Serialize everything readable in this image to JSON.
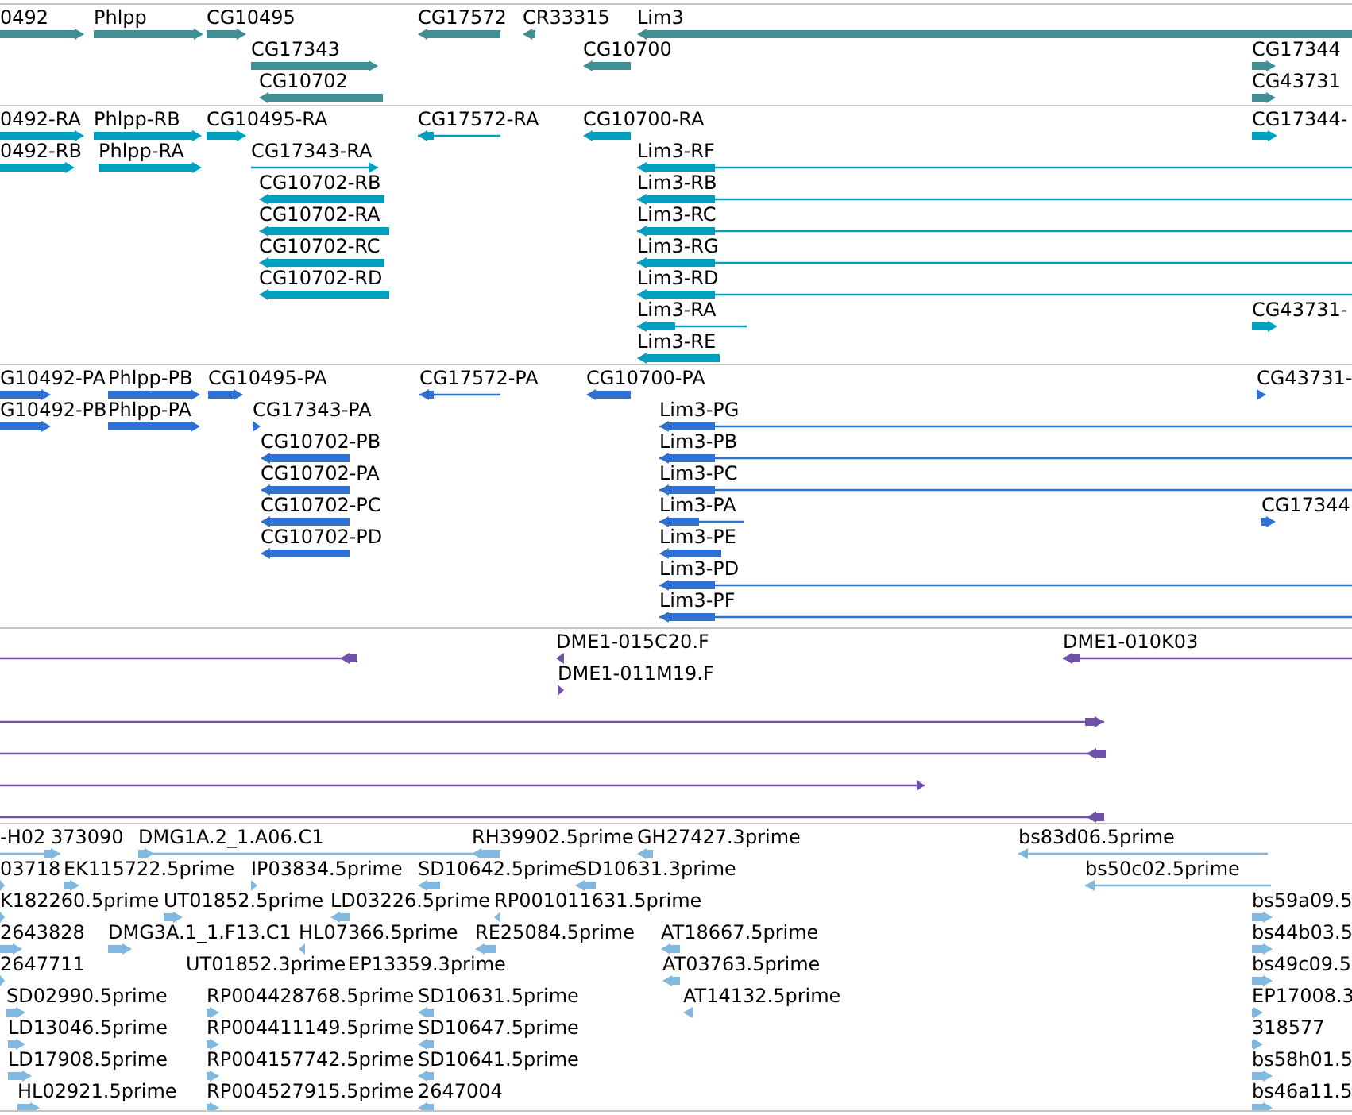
{
  "tracks": [
    {
      "color": "#3f8f94",
      "features": [
        {
          "label": "0492",
          "reverse": false
        },
        {
          "label": "Phlpp",
          "reverse": false
        },
        {
          "label": "CG10495",
          "reverse": false
        },
        {
          "label": "CG17572",
          "reverse": true
        },
        {
          "label": "CR33315",
          "reverse": true
        },
        {
          "label": "Lim3",
          "reverse": true
        },
        {
          "label": "CG17343",
          "reverse": false
        },
        {
          "label": "CG10700",
          "reverse": true
        },
        {
          "label": "CG17344",
          "reverse": false
        },
        {
          "label": "CG10702",
          "reverse": true
        },
        {
          "label": "CG43731",
          "reverse": false
        }
      ]
    },
    {
      "color": "#009fc0",
      "features": [
        {
          "label": "0492-RA",
          "reverse": false
        },
        {
          "label": "Phlpp-RB",
          "reverse": false
        },
        {
          "label": "CG10495-RA",
          "reverse": false
        },
        {
          "label": "CG17572-RA",
          "reverse": true
        },
        {
          "label": "CG10700-RA",
          "reverse": true
        },
        {
          "label": "CG17344-",
          "reverse": false
        },
        {
          "label": "0492-RB",
          "reverse": false
        },
        {
          "label": "Phlpp-RA",
          "reverse": false
        },
        {
          "label": "CG17343-RA",
          "reverse": false
        },
        {
          "label": "Lim3-RF",
          "reverse": true
        },
        {
          "label": "CG10702-RB",
          "reverse": true
        },
        {
          "label": "Lim3-RB",
          "reverse": true
        },
        {
          "label": "CG10702-RA",
          "reverse": true
        },
        {
          "label": "Lim3-RC",
          "reverse": true
        },
        {
          "label": "CG10702-RC",
          "reverse": true
        },
        {
          "label": "Lim3-RG",
          "reverse": true
        },
        {
          "label": "CG10702-RD",
          "reverse": true
        },
        {
          "label": "Lim3-RD",
          "reverse": true
        },
        {
          "label": "Lim3-RA",
          "reverse": true
        },
        {
          "label": "CG43731-",
          "reverse": false
        },
        {
          "label": "Lim3-RE",
          "reverse": true
        }
      ]
    },
    {
      "color": "#3070d0",
      "features": [
        {
          "label": "G10492-PA",
          "reverse": false
        },
        {
          "label": "Phlpp-PB",
          "reverse": false
        },
        {
          "label": "CG10495-PA",
          "reverse": false
        },
        {
          "label": "CG17572-PA",
          "reverse": true
        },
        {
          "label": "CG10700-PA",
          "reverse": true
        },
        {
          "label": "CG43731-",
          "reverse": false
        },
        {
          "label": "G10492-PB",
          "reverse": false
        },
        {
          "label": "Phlpp-PA",
          "reverse": false
        },
        {
          "label": "CG17343-PA",
          "reverse": false
        },
        {
          "label": "Lim3-PG",
          "reverse": true
        },
        {
          "label": "CG10702-PB",
          "reverse": true
        },
        {
          "label": "Lim3-PB",
          "reverse": true
        },
        {
          "label": "CG10702-PA",
          "reverse": true
        },
        {
          "label": "Lim3-PC",
          "reverse": true
        },
        {
          "label": "CG10702-PC",
          "reverse": true
        },
        {
          "label": "Lim3-PA",
          "reverse": true
        },
        {
          "label": "CG17344",
          "reverse": false
        },
        {
          "label": "CG10702-PD",
          "reverse": true
        },
        {
          "label": "Lim3-PE",
          "reverse": true
        },
        {
          "label": "Lim3-PD",
          "reverse": true
        },
        {
          "label": "Lim3-PF",
          "reverse": true
        }
      ]
    },
    {
      "color": "#7050a8",
      "features": [
        {
          "reverse": true
        },
        {
          "label": "DME1-015C20.F",
          "reverse": true
        },
        {
          "label": "DME1-010K03",
          "reverse": true
        },
        {
          "label": "DME1-011M19.F",
          "reverse": false
        },
        {
          "reverse": false
        },
        {
          "reverse": true
        },
        {
          "reverse": false
        },
        {
          "reverse": true
        }
      ]
    },
    {
      "color": "#80b8e0",
      "features": [
        {
          "label": "-H02",
          "reverse": false
        },
        {
          "label": "373090"
        },
        {
          "label": "DMG1A.2_1.A06.C1",
          "reverse": false
        },
        {
          "label": "RH39902.5prime",
          "reverse": true
        },
        {
          "label": "GH27427.3prime",
          "reverse": true
        },
        {
          "label": "bs83d06.5prime",
          "reverse": true
        },
        {
          "label": "03718",
          "reverse": false
        },
        {
          "label": "EK115722.5prime",
          "reverse": false
        },
        {
          "label": "IP03834.5prime",
          "reverse": false
        },
        {
          "label": "SD10642.5prime",
          "reverse": true
        },
        {
          "label": "SD10631.3prime",
          "reverse": true
        },
        {
          "label": "bs50c02.5prime",
          "reverse": true
        },
        {
          "label": "K182260.5prime",
          "reverse": false
        },
        {
          "label": "UT01852.5prime",
          "reverse": false
        },
        {
          "label": "LD03226.5prime",
          "reverse": true
        },
        {
          "label": "RP001011631.5prime",
          "reverse": true
        },
        {
          "label": "bs59a09.5",
          "reverse": false
        },
        {
          "label": "2643828",
          "reverse": false
        },
        {
          "label": "DMG3A.1_1.F13.C1",
          "reverse": false
        },
        {
          "label": "HL07366.5prime",
          "reverse": true
        },
        {
          "label": "RE25084.5prime",
          "reverse": true
        },
        {
          "label": "AT18667.5prime",
          "reverse": true
        },
        {
          "label": "bs44b03.5",
          "reverse": false
        },
        {
          "label": "2647711",
          "reverse": false
        },
        {
          "label": "UT01852.3prime"
        },
        {
          "label": "EP13359.3prime"
        },
        {
          "label": "AT03763.5prime",
          "reverse": true
        },
        {
          "label": "bs49c09.5",
          "reverse": false
        },
        {
          "label": "SD02990.5prime",
          "reverse": false
        },
        {
          "label": "RP004428768.5prime",
          "reverse": false
        },
        {
          "label": "SD10631.5prime",
          "reverse": true
        },
        {
          "label": "AT14132.5prime",
          "reverse": true
        },
        {
          "label": "EP17008.3",
          "reverse": false
        },
        {
          "label": "LD13046.5prime",
          "reverse": false
        },
        {
          "label": "RP004411149.5prime",
          "reverse": false
        },
        {
          "label": "SD10647.5prime",
          "reverse": true
        },
        {
          "label": "318577",
          "reverse": false
        },
        {
          "label": "LD17908.5prime",
          "reverse": false
        },
        {
          "label": "RP004157742.5prime",
          "reverse": false
        },
        {
          "label": "SD10641.5prime",
          "reverse": true
        },
        {
          "label": "bs58h01.5",
          "reverse": false
        },
        {
          "label": "HL02921.5prime",
          "reverse": false
        },
        {
          "label": "RP004527915.5prime",
          "reverse": false
        },
        {
          "label": "2647004",
          "reverse": true
        },
        {
          "label": "bs46a11.5",
          "reverse": false
        }
      ]
    }
  ]
}
